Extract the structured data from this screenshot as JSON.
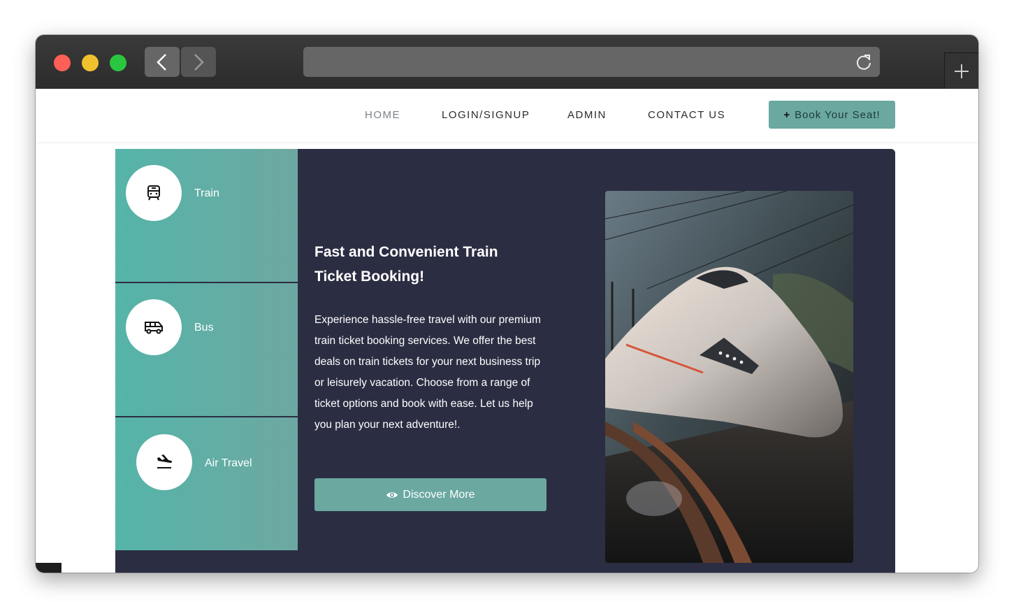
{
  "nav": {
    "home": "HOME",
    "login": "LOGIN/SIGNUP",
    "admin": "ADMIN",
    "contact": "CONTACT US",
    "book_label": "Book Your Seat!"
  },
  "sidebar": {
    "items": [
      {
        "label": "Train",
        "icon": "train-icon"
      },
      {
        "label": "Bus",
        "icon": "bus-icon"
      },
      {
        "label": "Air Travel",
        "icon": "plane-landing-icon"
      }
    ]
  },
  "hero": {
    "title": "Fast and Convenient Train Ticket Booking!",
    "body": "Experience hassle-free travel with our premium train ticket booking services. We offer the best deals on train tickets for your next business trip or leisurely vacation. Choose from a range of ticket options and book with ease. Let us help you plan your next adventure!.",
    "cta": "Discover More"
  },
  "colors": {
    "accent": "#6aa8a0",
    "sidebar": "#55b4a9",
    "hero_bg": "#2b2d42"
  }
}
